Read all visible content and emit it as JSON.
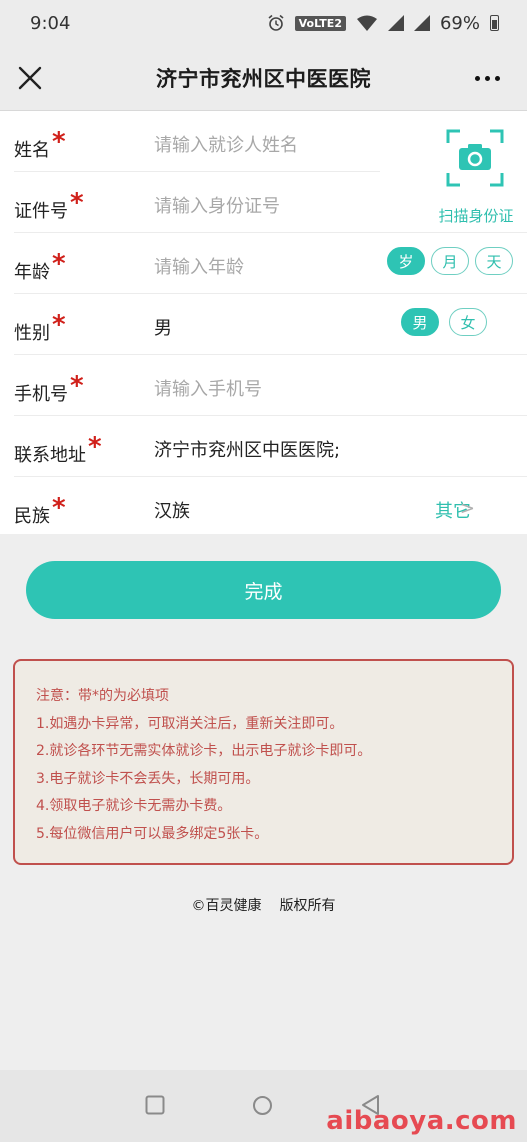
{
  "status_bar": {
    "time": "9:04",
    "network_badge": "VoLTE2",
    "battery": "69%"
  },
  "nav": {
    "title": "济宁市兖州区中医医院",
    "close_icon": "close-icon",
    "more_icon": "more-icon"
  },
  "form": {
    "required_mark": "*",
    "name": {
      "label": "姓名",
      "placeholder": "请输入就诊人姓名"
    },
    "id_number": {
      "label": "证件号",
      "placeholder": "请输入身份证号"
    },
    "scan": {
      "label": "扫描身份证",
      "icon": "camera-scan-icon"
    },
    "age": {
      "label": "年龄",
      "placeholder": "请输入年龄",
      "units": [
        "岁",
        "月",
        "天"
      ],
      "selected_unit": "岁"
    },
    "gender": {
      "label": "性别",
      "value": "男",
      "options": [
        "男",
        "女"
      ],
      "selected": "男"
    },
    "phone": {
      "label": "手机号",
      "placeholder": "请输入手机号"
    },
    "address": {
      "label": "联系地址",
      "value": "济宁市兖州区中医医院;"
    },
    "ethnicity": {
      "label": "民族",
      "value": "汉族",
      "other_label": "其它",
      "chevron": ">"
    }
  },
  "submit": {
    "label": "完成"
  },
  "notice": {
    "title": "注意：带*的为必填项",
    "items": [
      "1.如遇办卡异常，可取消关注后，重新关注即可。",
      "2.就诊各环节无需实体就诊卡，出示电子就诊卡即可。",
      "3.电子就诊卡不会丢失，长期可用。",
      "4.领取电子就诊卡无需办卡费。",
      "5.每位微信用户可以最多绑定5张卡。"
    ]
  },
  "footer": {
    "brand": "©百灵健康",
    "rights": "版权所有"
  },
  "watermark": "aibaoya.com",
  "colors": {
    "accent": "#2ec4b4",
    "required": "#d0201a",
    "notice_text": "#c0504d",
    "notice_bg": "#efebe4"
  }
}
